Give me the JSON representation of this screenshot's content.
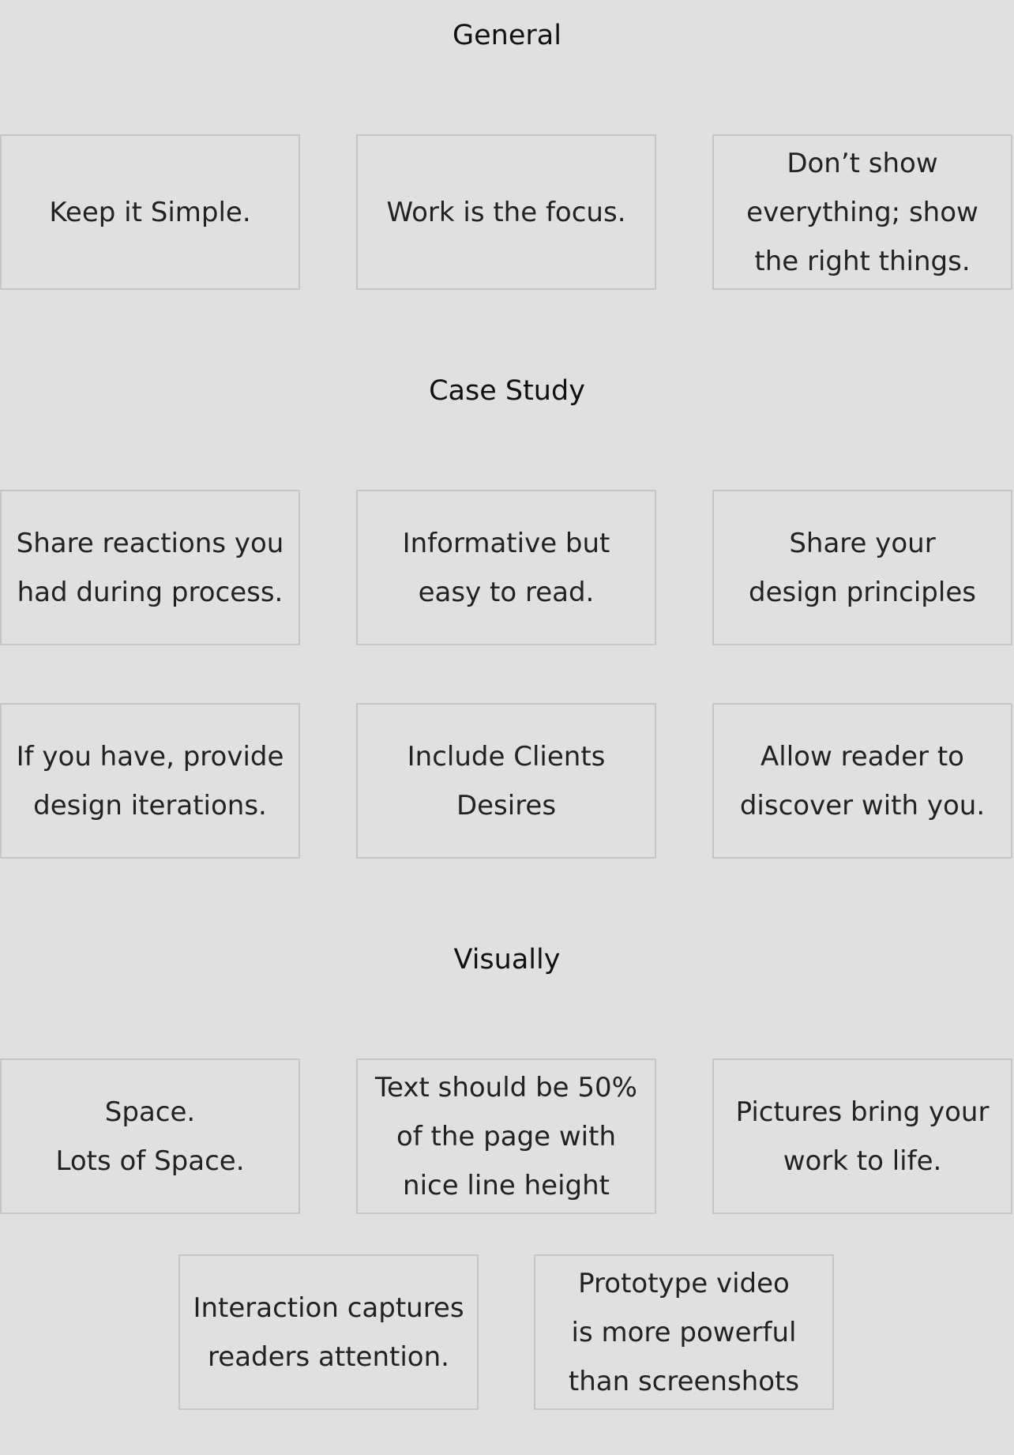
{
  "sections": {
    "general": {
      "title": "General",
      "cards": [
        "Keep it Simple.",
        "Work is the focus.",
        "Don’t show\neverything; show\nthe right things."
      ]
    },
    "case_study": {
      "title": "Case Study",
      "cards": [
        "Share reactions you\nhad during process.",
        "Informative but\neasy to read.",
        "Share your\ndesign principles",
        "If you have, provide\ndesign iterations.",
        "Include Clients\nDesires",
        "Allow reader to\ndiscover with you."
      ]
    },
    "visually": {
      "title": "Visually",
      "cards": [
        "Space.\nLots of Space.",
        "Text should be 50%\nof the page with\nnice line height",
        "Pictures bring your\nwork to life.",
        "Interaction captures\nreaders attention.",
        "Prototype video\nis more powerful\nthan screenshots"
      ]
    }
  }
}
